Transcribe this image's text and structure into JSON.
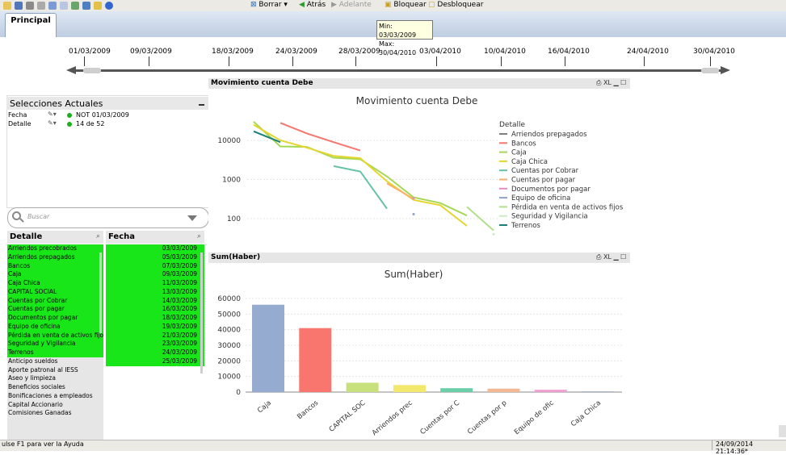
{
  "toolbar": {
    "borrar_label": "Borrar",
    "atras_label": "Atrás",
    "adelante_label": "Adelante",
    "bloquear_label": "Bloquear",
    "desbloquear_label": "Desbloquear"
  },
  "tooltip": {
    "min": "Min: 03/03/2009",
    "max": "Max: 30/04/2010"
  },
  "tabs": [
    {
      "label": "Principal"
    }
  ],
  "timeline": {
    "labels": [
      "01/03/2009",
      "09/03/2009",
      "18/03/2009",
      "24/03/2009",
      "28/03/2009",
      "03/04/2010",
      "10/04/2010",
      "16/04/2010",
      "24/04/2010",
      "30/04/2010"
    ]
  },
  "current_selections": {
    "title": "Selecciones Actuales",
    "rows": [
      {
        "field": "Fecha",
        "value": "NOT 01/03/2009"
      },
      {
        "field": "Detalle",
        "value": "14 de 52"
      }
    ]
  },
  "search": {
    "placeholder": "Buscar"
  },
  "detalle_list": {
    "title": "Detalle",
    "items": [
      {
        "label": "Arriendos precobrados",
        "selected": true
      },
      {
        "label": "Arriendos prepagados",
        "selected": true
      },
      {
        "label": "Bancos",
        "selected": true
      },
      {
        "label": "Caja",
        "selected": true
      },
      {
        "label": "Caja Chica",
        "selected": true
      },
      {
        "label": "CAPITAL SOCIAL",
        "selected": true
      },
      {
        "label": "Cuentas por Cobrar",
        "selected": true
      },
      {
        "label": "Cuentas por pagar",
        "selected": true
      },
      {
        "label": "Documentos por pagar",
        "selected": true
      },
      {
        "label": "Equipo de oficina",
        "selected": true
      },
      {
        "label": "Pérdida en venta de activos fijos",
        "selected": true
      },
      {
        "label": "Seguridad y Vigilancia",
        "selected": true
      },
      {
        "label": "Terrenos",
        "selected": true
      },
      {
        "label": "Anticipo sueldos",
        "selected": false
      },
      {
        "label": "Aporte patronal al IESS",
        "selected": false
      },
      {
        "label": "Aseo y limpieza",
        "selected": false
      },
      {
        "label": "Beneficios sociales",
        "selected": false
      },
      {
        "label": "Bonificaciones a empleados",
        "selected": false
      },
      {
        "label": "Capital Accionario",
        "selected": false
      },
      {
        "label": "Comisiones Ganadas",
        "selected": false
      }
    ]
  },
  "fecha_list": {
    "title": "Fecha",
    "items": [
      "03/03/2009",
      "05/03/2009",
      "07/03/2009",
      "09/03/2009",
      "11/03/2009",
      "13/03/2009",
      "14/03/2009",
      "16/03/2009",
      "18/03/2009",
      "19/03/2009",
      "21/03/2009",
      "23/03/2009",
      "24/03/2009",
      "25/03/2009"
    ]
  },
  "line_chart_panel": {
    "caption": "Movimiento cuenta Debe",
    "icons": "XL"
  },
  "bar_chart_panel": {
    "caption": "Sum(Haber)",
    "icons": "XL"
  },
  "colors": {
    "selected_green": "#19e619",
    "series": [
      "#7f7f7f",
      "#f8766d",
      "#a6d854",
      "#e5d530",
      "#66c2a5",
      "#fdae6b",
      "#e78ac3",
      "#8da0cb",
      "#b2df8a",
      "#ccebc5",
      "#1b7f79"
    ]
  },
  "chart_data": [
    {
      "type": "line",
      "title": "Movimiento cuenta Debe",
      "y_scale": "log",
      "y_ticks": [
        "10000",
        "1000",
        "100"
      ],
      "legend_title": "Detalle",
      "legend_position": "right",
      "series": [
        {
          "name": "Arriendos prepagados",
          "values": []
        },
        {
          "name": "Bancos",
          "points": [
            [
              0,
              28000
            ],
            [
              1,
              15000
            ],
            [
              2,
              9000
            ],
            [
              3,
              5500
            ]
          ]
        },
        {
          "name": "Caja",
          "points": [
            [
              0,
              30000
            ],
            [
              1,
              7000
            ],
            [
              2,
              6800
            ],
            [
              3,
              3600
            ],
            [
              4,
              3300
            ],
            [
              5,
              1200
            ],
            [
              6,
              350
            ],
            [
              7,
              250
            ],
            [
              8,
              120
            ]
          ]
        },
        {
          "name": "Caja Chica",
          "points": [
            [
              0,
              25000
            ],
            [
              1,
              10000
            ],
            [
              2,
              6500
            ],
            [
              3,
              4000
            ],
            [
              4,
              3500
            ],
            [
              5,
              900
            ],
            [
              6,
              300
            ],
            [
              7,
              220
            ],
            [
              8,
              65
            ]
          ]
        },
        {
          "name": "Cuentas por Cobrar",
          "points": [
            [
              0,
              2200
            ],
            [
              1,
              1600
            ],
            [
              2,
              180
            ]
          ]
        },
        {
          "name": "Cuentas por pagar",
          "points": [
            [
              0,
              800
            ],
            [
              1,
              320
            ]
          ]
        },
        {
          "name": "Documentos por pagar",
          "points": [
            [
              0,
              330
            ]
          ]
        },
        {
          "name": "Equipo de oficina",
          "points": [
            [
              0,
              130
            ]
          ]
        },
        {
          "name": "Pérdida en venta de activos fijos",
          "points": [
            [
              0,
              200
            ],
            [
              1,
              50
            ]
          ]
        },
        {
          "name": "Seguridad y Vigilancia",
          "points": [
            [
              0,
              40
            ]
          ]
        },
        {
          "name": "Terrenos",
          "points": [
            [
              0,
              17000
            ],
            [
              1,
              9000
            ]
          ]
        }
      ]
    },
    {
      "type": "bar",
      "title": "Sum(Haber)",
      "categories": [
        "Caja",
        "Bancos",
        "CAPITAL SOC",
        "Arriendos prec",
        "Cuentas por C",
        "Cuentas por p",
        "Equipo de ofic",
        "Caja Chica"
      ],
      "values": [
        56000,
        41000,
        6000,
        4500,
        2500,
        2200,
        1500,
        500
      ],
      "colors": [
        "#95acd0",
        "#f8766d",
        "#c8e07c",
        "#f2e86c",
        "#6ccfa8",
        "#f5b894",
        "#eea0d0",
        "#aab4c8"
      ],
      "y_ticks": [
        0,
        10000,
        20000,
        30000,
        40000,
        50000,
        60000
      ],
      "ylim": [
        0,
        65000
      ]
    }
  ],
  "status": {
    "help_text": "ulse F1 para ver la Ayuda",
    "timestamp": "24/09/2014 21:14:36*"
  }
}
